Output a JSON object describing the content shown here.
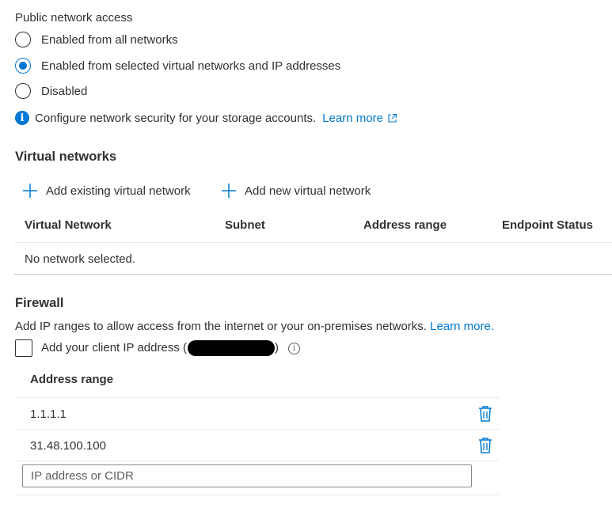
{
  "public_access": {
    "label": "Public network access",
    "options": [
      {
        "label": "Enabled from all networks",
        "selected": false
      },
      {
        "label": "Enabled from selected virtual networks and IP addresses",
        "selected": true
      },
      {
        "label": "Disabled",
        "selected": false
      }
    ],
    "info_text": "Configure network security for your storage accounts.",
    "learn_more": "Learn more"
  },
  "virtual_networks": {
    "heading": "Virtual networks",
    "add_existing": "Add existing virtual network",
    "add_new": "Add new virtual network",
    "columns": [
      "Virtual Network",
      "Subnet",
      "Address range",
      "Endpoint Status"
    ],
    "empty_text": "No network selected."
  },
  "firewall": {
    "heading": "Firewall",
    "description": "Add IP ranges to allow access from the internet or your on-premises networks.",
    "learn_more": "Learn more.",
    "client_ip_label": "Add your client IP address (",
    "client_ip_close": ")",
    "client_ip_checked": false,
    "column": "Address range",
    "rows": [
      "1.1.1.1",
      "31.48.100.100"
    ],
    "input_placeholder": "IP address or CIDR"
  },
  "colors": {
    "accent": "#0078d4",
    "text": "#323130",
    "border": "#edebe9"
  }
}
